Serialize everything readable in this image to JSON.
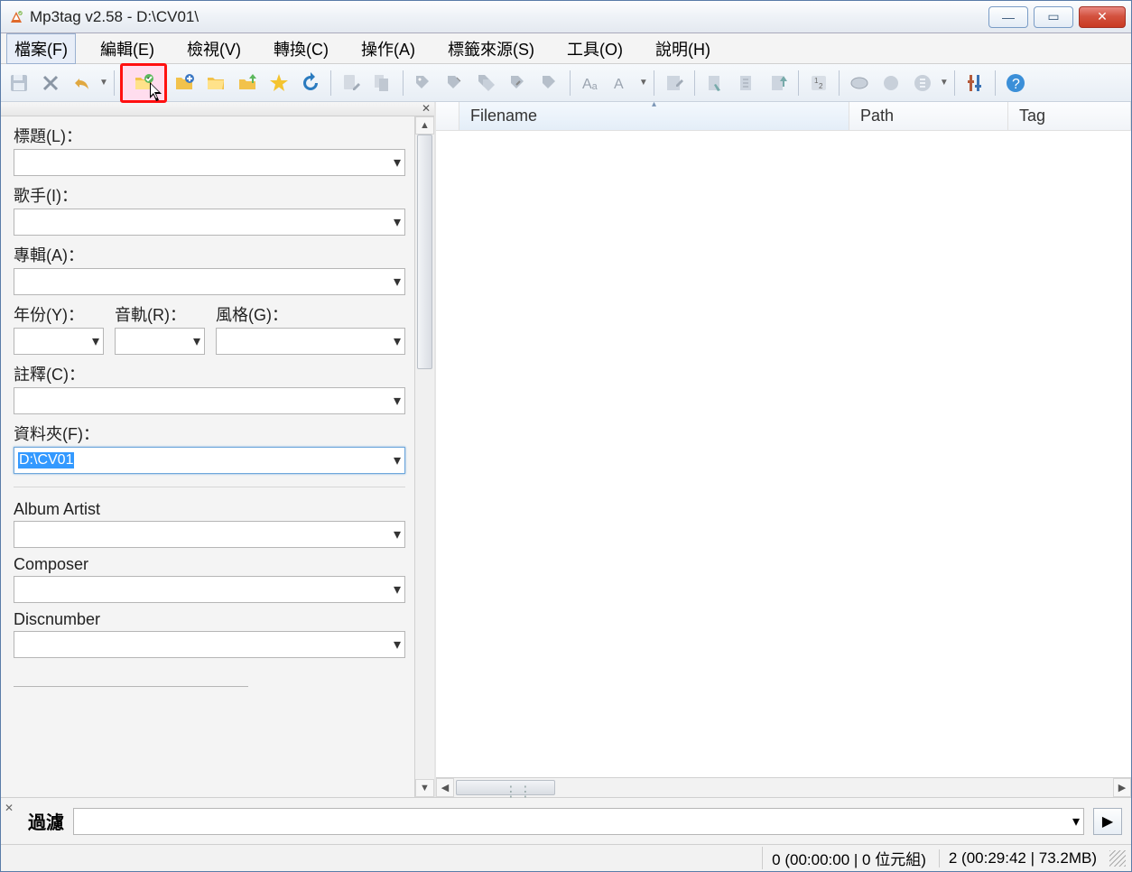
{
  "window": {
    "title": "Mp3tag v2.58  -  D:\\CV01\\"
  },
  "menu": {
    "file": "檔案(F)",
    "edit": "編輯(E)",
    "view": "檢視(V)",
    "convert": "轉換(C)",
    "action": "操作(A)",
    "tagsource": "標籤來源(S)",
    "tools": "工具(O)",
    "help": "說明(H)"
  },
  "toolbar": {
    "save": "save",
    "delete": "delete",
    "undo": "undo",
    "open_folder": "open-folder",
    "add_folder": "add-folder",
    "playlist": "playlist",
    "playlist_up": "playlist-up",
    "fav": "favorite",
    "refresh": "refresh",
    "file_rename": "file-rename",
    "file_copy": "file-copy",
    "tag_to_file": "tag-to-filename",
    "file_to_tag": "filename-to-tag",
    "other1": "tag-tag",
    "other2": "tag-swap",
    "other3": "tag-op",
    "case1": "case-conv",
    "case2": "case-conv2",
    "edit_tag": "edit-tag",
    "quick1": "quick1",
    "quick2": "quick2",
    "quick3": "quick3",
    "numbering": "auto-number",
    "web1": "web-source1",
    "web2": "web-source2",
    "web3": "web-source3",
    "settings": "settings",
    "help_btn": "help"
  },
  "panel": {
    "title_label": "標題(L)：",
    "artist_label": "歌手(I)：",
    "album_label": "專輯(A)：",
    "year_label": "年份(Y)：",
    "track_label": "音軌(R)：",
    "genre_label": "風格(G)：",
    "comment_label": "註釋(C)：",
    "folder_label": "資料夾(F)：",
    "folder_value": "D:\\CV01",
    "albumartist_label": "Album Artist",
    "composer_label": "Composer",
    "discnumber_label": "Discnumber"
  },
  "columns": {
    "filename": "Filename",
    "path": "Path",
    "tag": "Tag"
  },
  "filter": {
    "label": "過濾",
    "value": ""
  },
  "status": {
    "left": "0 (00:00:00 | 0 位元組)",
    "right": "2 (00:29:42 | 73.2MB)"
  }
}
